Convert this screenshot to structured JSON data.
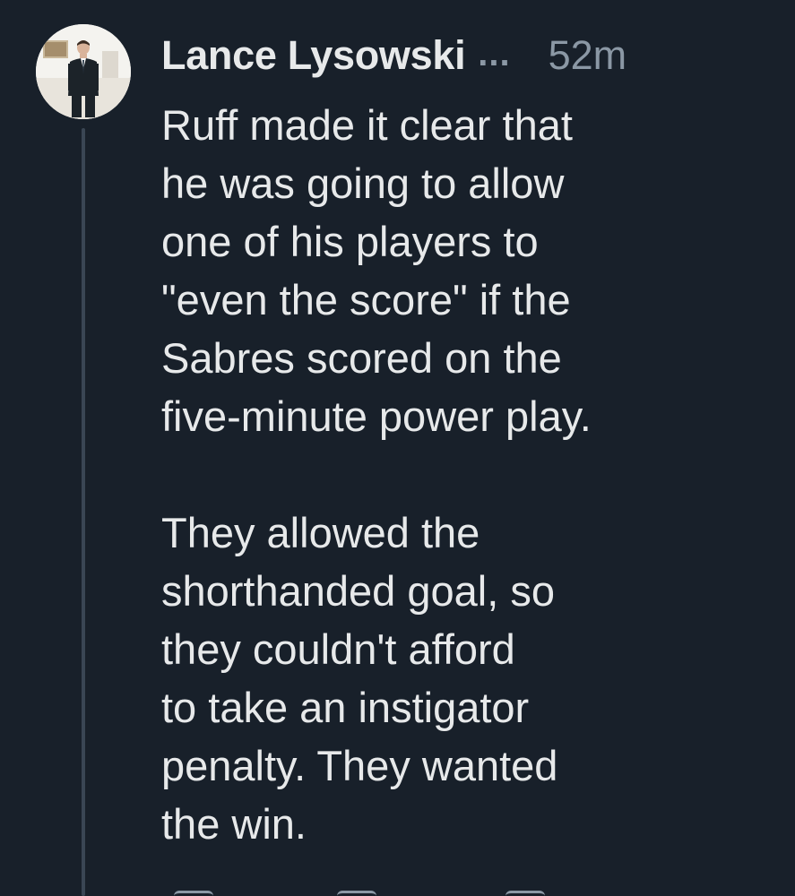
{
  "post": {
    "author": "Lance Lysowski",
    "more_glyph": "...",
    "timestamp": "52m",
    "paragraphs": [
      "Ruff made it clear that\nhe was going to allow\none of his players to\n\"even the score\" if the\nSabres scored on the\nfive-minute power play.",
      "They allowed the\nshorthanded goal, so\nthey couldn't afford\nto take an instigator\npenalty. They wanted\nthe win."
    ]
  },
  "icons": {
    "avatar": "profile-photo",
    "more": "more-options-icon",
    "reply": "reply-icon",
    "repost": "repost-icon",
    "like": "like-icon"
  },
  "colors": {
    "background": "#18202a",
    "text": "#e7e9ea",
    "muted": "#8b98a5",
    "thread_line": "#3a4654"
  }
}
